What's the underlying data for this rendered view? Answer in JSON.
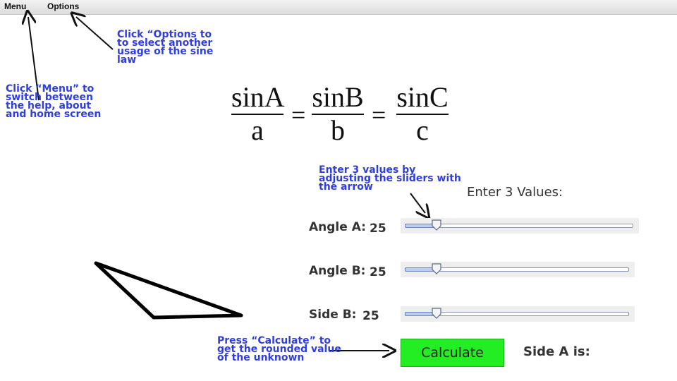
{
  "menubar": {
    "menu_label": "Menu",
    "options_label": "Options"
  },
  "notes": {
    "options_note": "Click “Options to to select another usage of the sine law",
    "menu_note": "Click “Menu” to switch between the help, about and home screen",
    "sliders_note": "Enter 3 values by adjusting the sliders with the arrow",
    "calculate_note": "Press “Calculate” to get the rounded value of the unknown"
  },
  "formula": {
    "fractions": [
      {
        "numerator": "sinA",
        "denominator": "a"
      },
      {
        "numerator": "sinB",
        "denominator": "b"
      },
      {
        "numerator": "sinC",
        "denominator": "c"
      }
    ],
    "equals": "="
  },
  "inputs": {
    "heading": "Enter 3 Values:",
    "rows": [
      {
        "label": "Angle A:",
        "value": "25",
        "fraction": 0.14
      },
      {
        "label": "Angle B:",
        "value": "25",
        "fraction": 0.14
      },
      {
        "label": "Side B:",
        "value": "25",
        "fraction": 0.14
      }
    ]
  },
  "actions": {
    "calculate_label": "Calculate",
    "result_label": "Side A is:"
  },
  "colors": {
    "note_blue": "#2f3ee0",
    "calculate_green": "#22ee22"
  }
}
